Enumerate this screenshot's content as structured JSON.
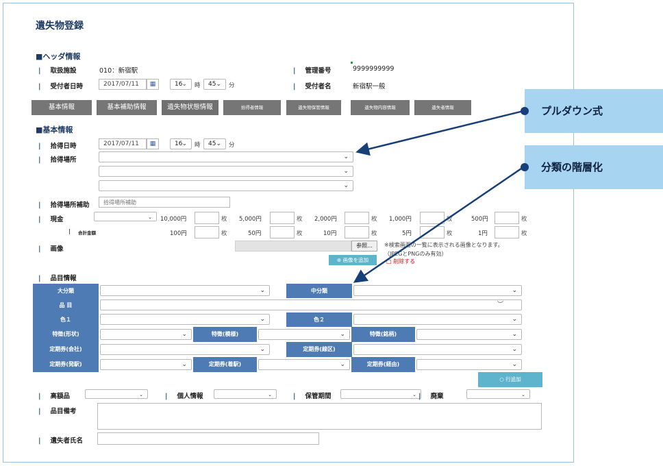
{
  "page_title": "遺失物登録",
  "header_section": {
    "title": "■ヘッダ情報",
    "facility_label": "取扱施設",
    "facility_value": "010：新宿駅",
    "management_no_label": "管理番号",
    "management_no_value": "9999999999",
    "received_datetime_label": "受付者日時",
    "received_date": "2017/07/11",
    "received_hour": "16",
    "hour_unit": "時",
    "received_minute": "45",
    "minute_unit": "分",
    "receiver_label": "受付者名",
    "receiver_value": "新宿駅一般"
  },
  "tabs": [
    "基本情報",
    "基本補助情報",
    "遺失物状態情報",
    "拾得者情報",
    "遺失物保管情報",
    "遺失物内容情報",
    "遺失者情報"
  ],
  "basic_section": {
    "title": "■基本情報",
    "found_date_label": "拾得日時",
    "found_date": "2017/07/11",
    "found_hour": "16",
    "hour_unit": "時",
    "found_minute": "45",
    "minute_unit": "分",
    "found_place_label": "拾得場所",
    "place_supplement_label": "拾得場所補助",
    "place_supplement_placeholder": "拾得場所補助",
    "cash_label": "現金",
    "total_label": "合計金額",
    "denominations_row1": [
      "10,000円",
      "5,000円",
      "2,000円",
      "1,000円",
      "500円"
    ],
    "denominations_row2": [
      "100円",
      "50円",
      "10円",
      "5円",
      "1円"
    ],
    "count_unit": "枚",
    "image_label": "画像",
    "browse_button": "参照...",
    "image_note_line1": "※検索画面の一覧に表示される画像となります。",
    "image_note_line2": "（JPEGとPNGのみ有効）",
    "add_image_button": "画像を追加",
    "delete_label": "削除する"
  },
  "item_section": {
    "title": "品目情報",
    "major_category": "大分類",
    "middle_category": "中分類",
    "item": "品 目",
    "color1": "色１",
    "color2": "色２",
    "feature_shape": "特徴(形状)",
    "feature_pattern": "特徴(模様)",
    "feature_brand": "特徴(銘柄)",
    "pass_company": "定期券(会社)",
    "pass_section": "定期券(線区)",
    "pass_from": "定期券(発駅)",
    "pass_to": "定期券(着駅)",
    "pass_via": "定期券(経由)",
    "add_row_button": "行追加"
  },
  "footer_fields": {
    "valuable_label": "高額品",
    "personal_info_label": "個人情報",
    "storage_period_label": "保管期間",
    "disposal_label": "廃棄",
    "item_remarks_label": "品目備考",
    "owner_name_label": "遺失者氏名"
  },
  "callouts": {
    "pulldown": "プルダウン式",
    "hierarchy": "分類の階層化"
  },
  "colors": {
    "accent_blue": "#4f7bb5",
    "tab_gray": "#767676",
    "callout_bg": "#a7d4f0",
    "arrow": "#173f7a"
  }
}
